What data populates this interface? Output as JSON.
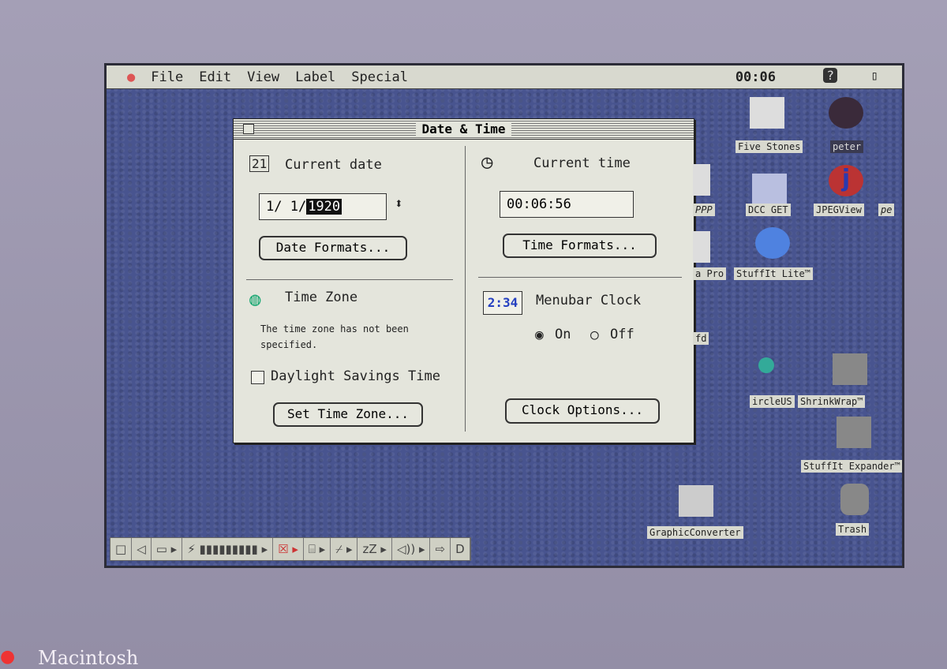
{
  "menubar": {
    "items": [
      "File",
      "Edit",
      "View",
      "Label",
      "Special"
    ],
    "clock": "00:06",
    "apple_icon": "apple-icon",
    "help_icon": "help-icon",
    "app_icon": "application-menu-icon"
  },
  "dialog": {
    "title": "Date & Time",
    "date": {
      "heading": "Current date",
      "value_prefix": "1/  1/",
      "value_selected": "1920",
      "button": "Date Formats..."
    },
    "time": {
      "heading": "Current time",
      "value": "00:06:56",
      "button": "Time Formats..."
    },
    "zone": {
      "heading": "Time Zone",
      "message": "The time zone has not been specified.",
      "dst_label": "Daylight Savings Time",
      "dst_checked": false,
      "button": "Set Time Zone..."
    },
    "menubar_clock": {
      "heading": "Menubar Clock",
      "icon_text": "2:34",
      "on_label": "On",
      "off_label": "Off",
      "selected": "On",
      "button": "Clock Options..."
    }
  },
  "desktop_icons": [
    "Five Stones",
    "peter",
    "PPP",
    "DCC GET",
    "JPEGView",
    "pe",
    "a Pro",
    "StuffIt Lite™",
    "fd",
    "ircleUS",
    "ShrinkWrap™",
    "StuffIt Expander™",
    "GraphicConverter",
    "Trash"
  ],
  "control_strip": [
    "collapse",
    "scroll-left",
    "monitors",
    "file-sharing",
    "battery",
    "apple-talk",
    "cd",
    "monitor-bit-depth",
    "sleep",
    "volume",
    "scroll-right",
    "tab"
  ],
  "bezel": {
    "brand": "Macintosh"
  }
}
